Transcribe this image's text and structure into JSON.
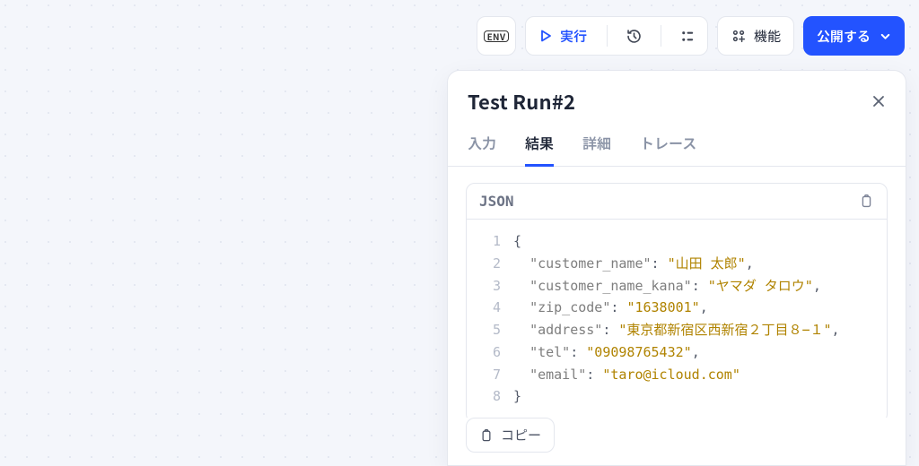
{
  "toolbar": {
    "env_label": "ENV",
    "run_label": "実行",
    "features_label": "機能",
    "publish_label": "公開する"
  },
  "panel": {
    "title": "Test Run#2",
    "tabs": [
      {
        "id": "input",
        "label": "入力",
        "active": false
      },
      {
        "id": "result",
        "label": "結果",
        "active": true
      },
      {
        "id": "detail",
        "label": "詳細",
        "active": false
      },
      {
        "id": "trace",
        "label": "トレース",
        "active": false
      }
    ],
    "json_badge": "JSON",
    "copy_label": "コピー",
    "json_fields": [
      {
        "key": "customer_name",
        "value": "山田 太郎"
      },
      {
        "key": "customer_name_kana",
        "value": "ヤマダ タロウ"
      },
      {
        "key": "zip_code",
        "value": "1638001"
      },
      {
        "key": "address",
        "value": "東京都新宿区西新宿２丁目８−１"
      },
      {
        "key": "tel",
        "value": "09098765432"
      },
      {
        "key": "email",
        "value": "taro@icloud.com"
      }
    ]
  }
}
